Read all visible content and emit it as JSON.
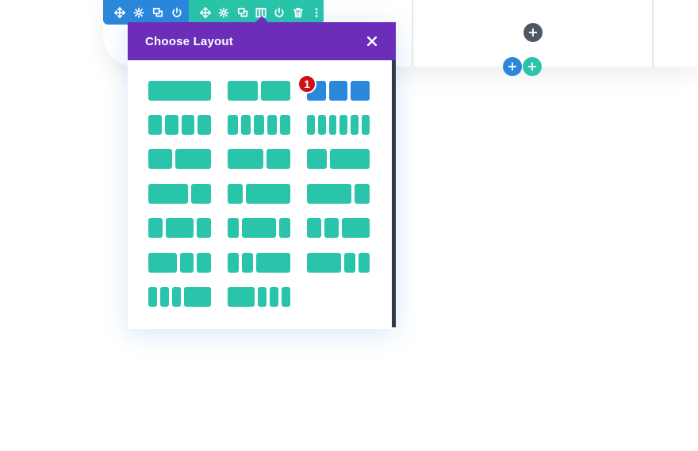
{
  "modal": {
    "title": "Choose Layout",
    "close_icon": "close-icon"
  },
  "badge": {
    "label": "1"
  },
  "colors": {
    "section_toolbar": "#2b87da",
    "row_toolbar": "#29c4a9",
    "modal_header": "#6c2eb9",
    "layout_option": "#29c4a9",
    "layout_selected": "#2b87da",
    "badge": "#d10e16"
  },
  "section_toolbar": {
    "icons": [
      "move-icon",
      "settings-icon",
      "duplicate-icon",
      "power-icon"
    ]
  },
  "row_toolbar": {
    "icons": [
      "move-icon",
      "settings-icon",
      "duplicate-icon",
      "columns-icon",
      "power-icon",
      "trash-icon",
      "more-icon"
    ]
  },
  "add_buttons": [
    "add-row-icon",
    "add-section-icon",
    "add-module-icon"
  ],
  "layouts": [
    {
      "name": "one-column",
      "ratios": [
        1
      ],
      "selected": false
    },
    {
      "name": "two-columns",
      "ratios": [
        1,
        1
      ],
      "selected": false
    },
    {
      "name": "three-columns",
      "ratios": [
        1,
        1,
        1
      ],
      "selected": true
    },
    {
      "name": "four-columns",
      "ratios": [
        1,
        1,
        1,
        1
      ],
      "selected": false
    },
    {
      "name": "five-columns",
      "ratios": [
        1,
        1,
        1,
        1,
        1
      ],
      "selected": false
    },
    {
      "name": "six-columns",
      "ratios": [
        1,
        1,
        1,
        1,
        1,
        1
      ],
      "selected": false
    },
    {
      "name": "two-fifths-three-fifths",
      "ratios": [
        2,
        3
      ],
      "selected": false
    },
    {
      "name": "three-fifths-two-fifths",
      "ratios": [
        3,
        2
      ],
      "selected": false
    },
    {
      "name": "one-third-two-thirds",
      "ratios": [
        1,
        2
      ],
      "selected": false
    },
    {
      "name": "two-thirds-one-third",
      "ratios": [
        2,
        1
      ],
      "selected": false
    },
    {
      "name": "one-fourth-three-fourths",
      "ratios": [
        1,
        3
      ],
      "selected": false
    },
    {
      "name": "three-fourths-one-fourth",
      "ratios": [
        3,
        1
      ],
      "selected": false
    },
    {
      "name": "one-fourth-half-one-fourth",
      "ratios": [
        1,
        2,
        1
      ],
      "selected": false
    },
    {
      "name": "one-fifth-three-fifths-one-fifth",
      "ratios": [
        1,
        3,
        1
      ],
      "selected": false
    },
    {
      "name": "one-fourth-one-fourth-half",
      "ratios": [
        1,
        1,
        2
      ],
      "selected": false
    },
    {
      "name": "half-one-fourth-one-fourth",
      "ratios": [
        2,
        1,
        1
      ],
      "selected": false
    },
    {
      "name": "one-fifth-one-fifth-three-fifths",
      "ratios": [
        1,
        1,
        3
      ],
      "selected": false
    },
    {
      "name": "three-fifths-one-fifth-one-fifth",
      "ratios": [
        3,
        1,
        1
      ],
      "selected": false
    },
    {
      "name": "one-sixth-one-sixth-one-sixth-half",
      "ratios": [
        1,
        1,
        1,
        3
      ],
      "selected": false
    },
    {
      "name": "half-one-sixth-one-sixth-one-sixth",
      "ratios": [
        3,
        1,
        1,
        1
      ],
      "selected": false
    }
  ]
}
